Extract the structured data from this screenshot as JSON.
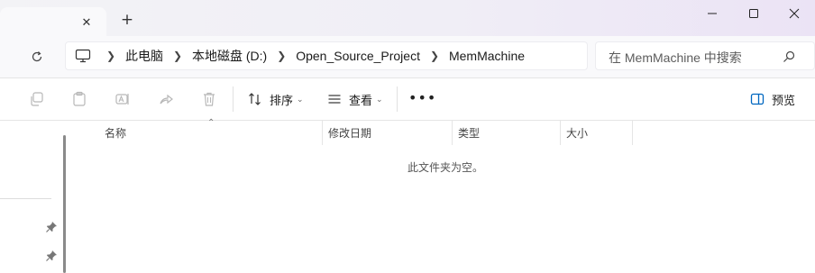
{
  "window": {
    "tab_close_glyph": "✕",
    "new_tab_glyph": "+",
    "minimize_icon": "minimize-icon",
    "maximize_icon": "maximize-icon",
    "close_icon": "close-icon"
  },
  "address_bar": {
    "breadcrumbs": [
      "此电脑",
      "本地磁盘 (D:)",
      "Open_Source_Project",
      "MemMachine"
    ],
    "search_placeholder": "在 MemMachine 中搜索"
  },
  "toolbar": {
    "sort_label": "排序",
    "view_label": "查看",
    "more_label": "•••",
    "preview_label": "预览"
  },
  "columns": [
    "名称",
    "修改日期",
    "类型",
    "大小"
  ],
  "empty_message": "此文件夹为空。",
  "colors": {
    "accent": "#0067c0",
    "disabled_icon": "#b8b8b8"
  }
}
